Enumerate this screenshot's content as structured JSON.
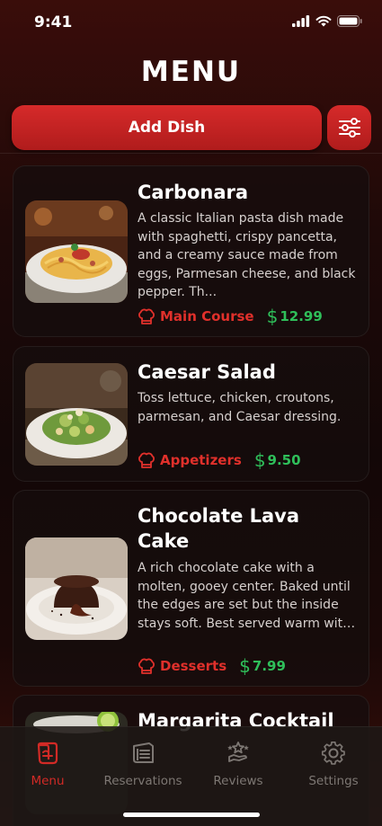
{
  "status": {
    "time": "9:41"
  },
  "header": {
    "title": "MENU"
  },
  "actions": {
    "add_label": "Add Dish"
  },
  "dishes": [
    {
      "name": "Carbonara",
      "description": "A classic Italian pasta dish made with spaghetti, crispy pancetta, and a creamy sauce made from eggs, Parmesan cheese, and black pepper. Th...",
      "category": "Main Course",
      "price": "12.99"
    },
    {
      "name": "Caesar Salad",
      "description": "Toss lettuce, chicken, croutons, parmesan, and Caesar dressing.",
      "category": "Appetizers",
      "price": "9.50"
    },
    {
      "name": "Chocolate Lava Cake",
      "description": "A rich chocolate cake with a molten, gooey center. Baked until the edges are set but the inside stays soft. Best served warm with ice cream or berri...",
      "category": "Desserts",
      "price": "7.99"
    },
    {
      "name": "Margarita Cocktail"
    }
  ],
  "tabs": [
    {
      "label": "Menu",
      "icon": "menu-book-icon",
      "active": true
    },
    {
      "label": "Reservations",
      "icon": "reservations-icon",
      "active": false
    },
    {
      "label": "Reviews",
      "icon": "reviews-icon",
      "active": false
    },
    {
      "label": "Settings",
      "icon": "gear-icon",
      "active": false
    }
  ],
  "colors": {
    "accent": "#d22a26",
    "price": "#2fbf5a",
    "tab_inactive": "#7d7773"
  }
}
